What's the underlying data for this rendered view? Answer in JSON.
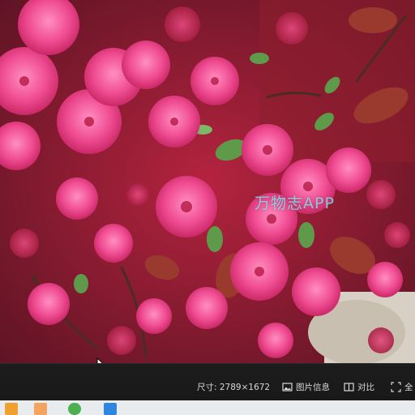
{
  "photo": {
    "subject": "",
    "watermark": "万物志APP"
  },
  "status_bar": {
    "size_label": "尺寸: 2789×1672",
    "info_button": "图片信息",
    "compare_button": "对比",
    "fullscreen_button": "全"
  },
  "icons": {
    "info": "image-info-icon",
    "compare": "compare-icon",
    "fullscreen": "fullscreen-icon",
    "cursor": "mouse-pointer-icon"
  },
  "colors": {
    "statusbar_bg": "#1b1b1b",
    "status_text": "#d8d8d8",
    "taskbar_bg": "#e9ecef"
  }
}
